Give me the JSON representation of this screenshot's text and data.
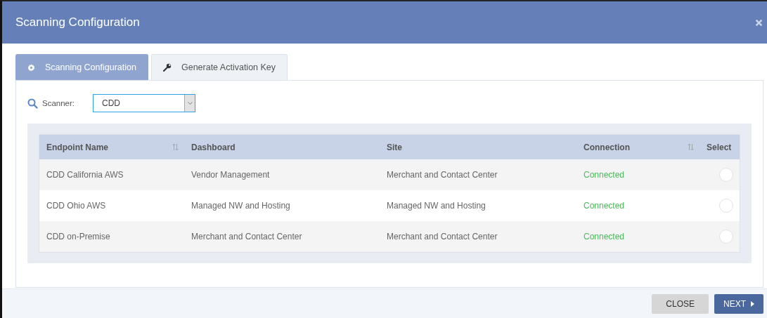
{
  "window": {
    "title": "Scanning Configuration"
  },
  "tabs": [
    {
      "label": "Scanning Configuration",
      "kind": "gear",
      "selected": true
    },
    {
      "label": "Generate Activation Key",
      "kind": "wrench",
      "selected": false
    }
  ],
  "scanner": {
    "label": "Scanner:",
    "value": "CDD"
  },
  "table": {
    "columns": [
      {
        "label": "Endpoint Name",
        "sortable": true
      },
      {
        "label": "Dashboard",
        "sortable": false
      },
      {
        "label": "Site",
        "sortable": false
      },
      {
        "label": "Connection",
        "sortable": true
      },
      {
        "label": "Select",
        "sortable": false
      }
    ],
    "rows": [
      {
        "endpoint": "CDD California AWS",
        "dashboard": "Vendor Management",
        "site": "Merchant and Contact Center",
        "connection": "Connected",
        "selected": false
      },
      {
        "endpoint": "CDD Ohio AWS",
        "dashboard": "Managed NW and Hosting",
        "site": "Managed NW and Hosting",
        "connection": "Connected",
        "selected": false
      },
      {
        "endpoint": "CDD on-Premise",
        "dashboard": "Merchant and Contact Center",
        "site": "Merchant and Contact Center",
        "connection": "Connected",
        "selected": false
      }
    ]
  },
  "buttons": [
    {
      "label": "CLOSE",
      "kind": "secondary"
    },
    {
      "label": "NEXT",
      "kind": "primary"
    }
  ]
}
